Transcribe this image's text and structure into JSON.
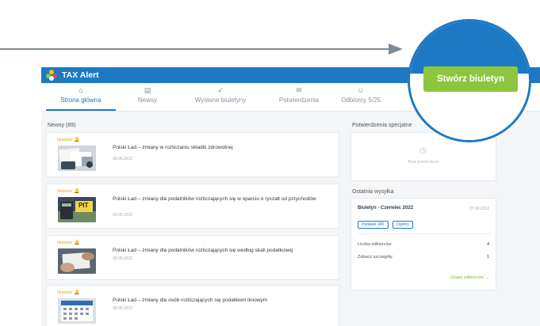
{
  "app": {
    "title": "TAX Alert"
  },
  "nav": {
    "tabs": [
      {
        "label": "Strona główna",
        "icon": "home-icon"
      },
      {
        "label": "Newsy",
        "icon": "newspaper-icon"
      },
      {
        "label": "Wysłane biuletyny",
        "icon": "paper-plane-icon"
      },
      {
        "label": "Potwierdzenia",
        "icon": "envelope-icon"
      },
      {
        "label": "Odbiorcy 5/25",
        "icon": "users-icon"
      }
    ],
    "active_tab": "Strona główna"
  },
  "news": {
    "header": "Newsy (89)",
    "badge_label": "Nowość",
    "items": [
      {
        "title": "Polski Ład – zmiany w rozliczaniu składki zdrowotnej",
        "date": "30.06.2022",
        "thumb": "documents-photo"
      },
      {
        "title": "Polski Ład – zmiany dla podatników rozliczających się w oparciu o ryczałt od przychodów",
        "date": "30.06.2022",
        "thumb": "pit-calculator-photo",
        "thumb_text": "PIT"
      },
      {
        "title": "Polski Ład – zmiany dla podatników rozliczających się według skali podatkowej",
        "date": "30.06.2022",
        "thumb": "hands-papers-photo"
      },
      {
        "title": "Polski Ład – zmiany dla osób rozliczających się podatkiem liniowym",
        "date": "30.06.2022",
        "thumb": "calendar-photo"
      }
    ]
  },
  "special": {
    "header": "Potwierdzenia specjalne",
    "empty_text": "Brak potwierdzeń"
  },
  "last_dispatch": {
    "header": "Ostatnia wysyłka",
    "bulletin_name": "Biuletyn - Czerwiec 2022",
    "bulletin_date": "27.06.2022",
    "chips": [
      "Podatek VAT",
      "Ogólny"
    ],
    "stats": [
      {
        "label": "Liczba odbiorców",
        "value": "4"
      },
      {
        "label": "Zobacz szczegóły",
        "value": "1"
      }
    ],
    "groups_link": "Grupy odbiorców →"
  },
  "cta": {
    "label": "Stwórz biuletyn"
  },
  "colors": {
    "brand_blue": "#1d79c3",
    "accent_green": "#8cc63f",
    "pointer_gray": "#7e8b98"
  }
}
